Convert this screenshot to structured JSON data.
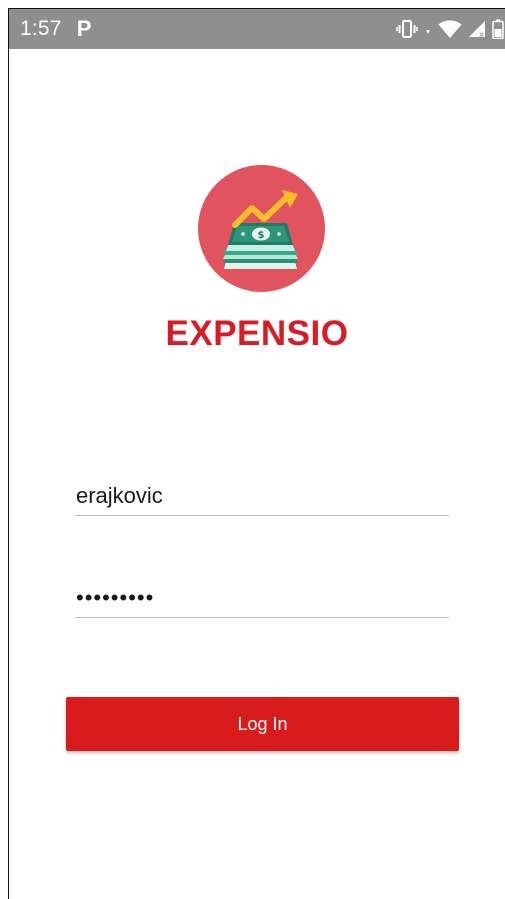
{
  "status_bar": {
    "time": "1:57",
    "notification_icon": "P",
    "icons": [
      "vibrate-icon",
      "data-arrows-icon",
      "wifi-icon",
      "cellular-signal-icon",
      "battery-icon"
    ],
    "background_color": "#8f8f8f"
  },
  "app": {
    "name": "EXPENSIO",
    "logo_icon": "money-growth-icon",
    "brand_color": "#d81b24",
    "logo_circle_color": "#e25360"
  },
  "login_form": {
    "username_value": "erajkovic",
    "password_value": "•••••••••",
    "login_button_label": "Log In",
    "button_color": "#d81b1b"
  }
}
